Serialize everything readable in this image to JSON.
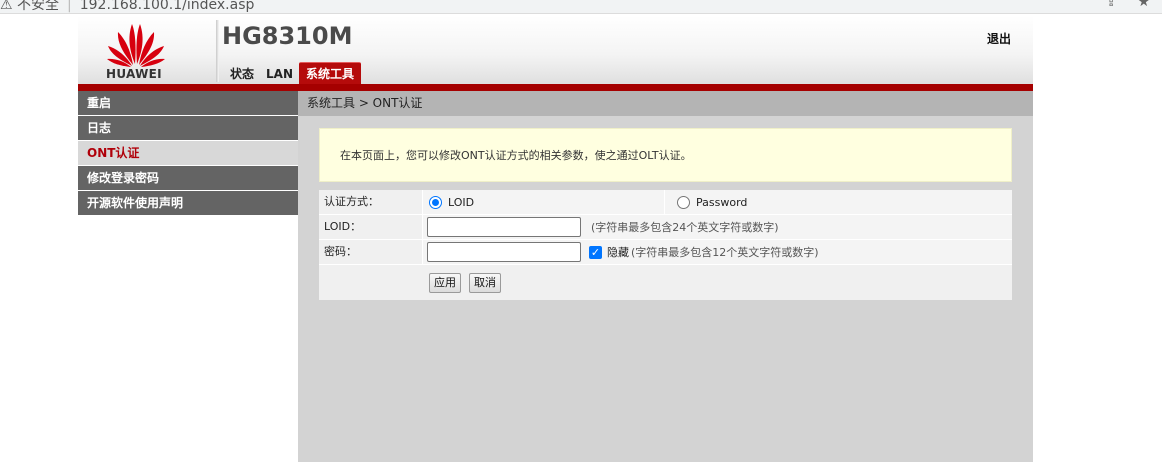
{
  "browser": {
    "security_label": "不安全",
    "url": "192.168.100.1/index.asp",
    "security_icon": "warning-icon"
  },
  "header": {
    "brand": "HUAWEI",
    "product": "HG8310M",
    "logout": "退出",
    "nav": [
      "状态",
      "LAN",
      "系统工具"
    ],
    "active_nav": "系统工具"
  },
  "sidebar": {
    "items": [
      {
        "label": "重启"
      },
      {
        "label": "日志"
      },
      {
        "label": "ONT认证"
      },
      {
        "label": "修改登录密码"
      },
      {
        "label": "开源软件使用声明"
      }
    ],
    "active": "ONT认证"
  },
  "main": {
    "breadcrumb": "系统工具 > ONT认证",
    "notice": "在本页面上，您可以修改ONT认证方式的相关参数，使之通过OLT认证。",
    "auth_label": "认证方式：",
    "auth_options": [
      "LOID",
      "Password"
    ],
    "auth_selected": "LOID",
    "loid_label": "LOID：",
    "loid_value": "",
    "loid_hint": "(字符串最多包含24个英文字符或数字)",
    "password_label": "密码：",
    "password_value": "",
    "hide_label": "隐藏",
    "hide_checked": true,
    "password_hint": "(字符串最多包含12个英文字符或数字)",
    "apply_button": "应用",
    "cancel_button": "取消"
  },
  "colors": {
    "brand_red": "#a50000",
    "active_tab": "#b50b0b",
    "sidebar_bg": "#646464",
    "notice_bg": "#ffffe0",
    "accent_blue": "#0075ff"
  }
}
